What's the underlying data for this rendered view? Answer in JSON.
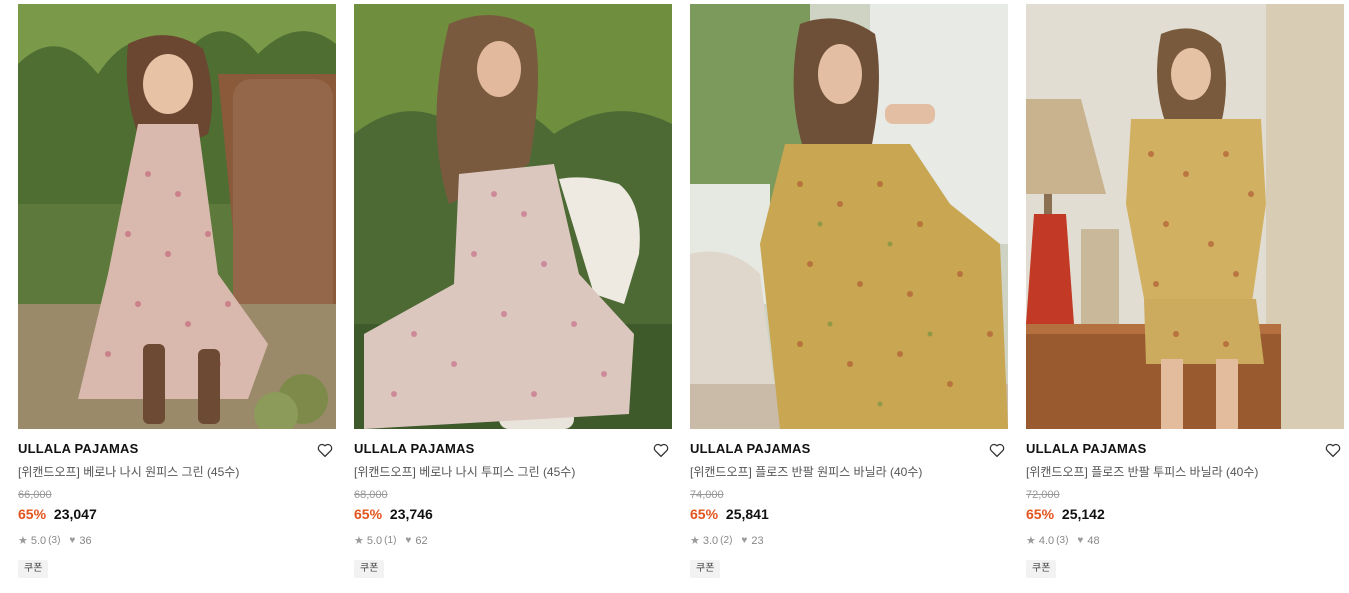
{
  "products": [
    {
      "brand": "ULLALA PAJAMAS",
      "name": "[위캔드오프] 베로나 나시 원피스 그린 (45수)",
      "original_price": "66,000",
      "discount": "65%",
      "price": "23,047",
      "rating": "5.0",
      "review_count": "(3)",
      "likes": "36",
      "coupon": "쿠폰",
      "image_icon": "product-photo",
      "wishlist_icon": "heart-outline-icon"
    },
    {
      "brand": "ULLALA PAJAMAS",
      "name": "[위캔드오프] 베로나 나시 투피스 그린 (45수)",
      "original_price": "68,000",
      "discount": "65%",
      "price": "23,746",
      "rating": "5.0",
      "review_count": "(1)",
      "likes": "62",
      "coupon": "쿠폰",
      "image_icon": "product-photo",
      "wishlist_icon": "heart-outline-icon"
    },
    {
      "brand": "ULLALA PAJAMAS",
      "name": "[위캔드오프] 플로즈 반팔 원피스 바닐라 (40수)",
      "original_price": "74,000",
      "discount": "65%",
      "price": "25,841",
      "rating": "3.0",
      "review_count": "(2)",
      "likes": "23",
      "coupon": "쿠폰",
      "image_icon": "product-photo",
      "wishlist_icon": "heart-outline-icon"
    },
    {
      "brand": "ULLALA PAJAMAS",
      "name": "[위캔드오프] 플로즈 반팔 투피스 바닐라 (40수)",
      "original_price": "72,000",
      "discount": "65%",
      "price": "25,142",
      "rating": "4.0",
      "review_count": "(3)",
      "likes": "48",
      "coupon": "쿠폰",
      "image_icon": "product-photo",
      "wishlist_icon": "heart-outline-icon"
    }
  ],
  "colors": {
    "discount": "#e2541c",
    "brand_text": "#111111",
    "muted": "#888888",
    "coupon_bg": "#f2f2f2"
  }
}
